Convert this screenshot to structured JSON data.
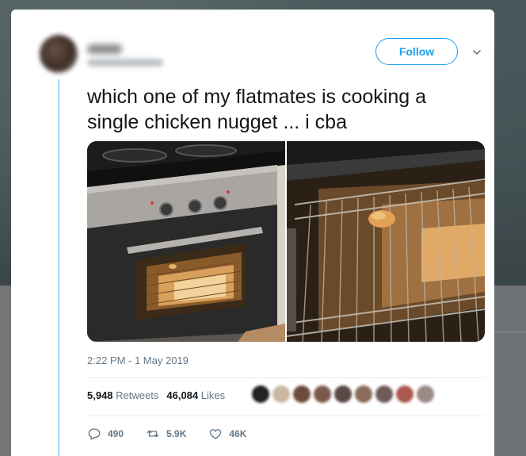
{
  "tweet": {
    "text": "which one of my flatmates is cooking a single chicken nugget ... i cba",
    "follow_label": "Follow",
    "timestamp": "2:22 PM - 1 May 2019",
    "stats": {
      "retweets_count": "5,948",
      "retweets_label": "Retweets",
      "likes_count": "46,084",
      "likes_label": "Likes"
    },
    "actions": {
      "replies": "490",
      "retweets": "5.9K",
      "likes": "46K"
    }
  },
  "colors": {
    "accent": "#1da1f2",
    "text": "#14171a",
    "muted": "#657786"
  },
  "icons": [
    "chevron-down-icon",
    "reply-icon",
    "retweet-icon",
    "heart-icon"
  ]
}
